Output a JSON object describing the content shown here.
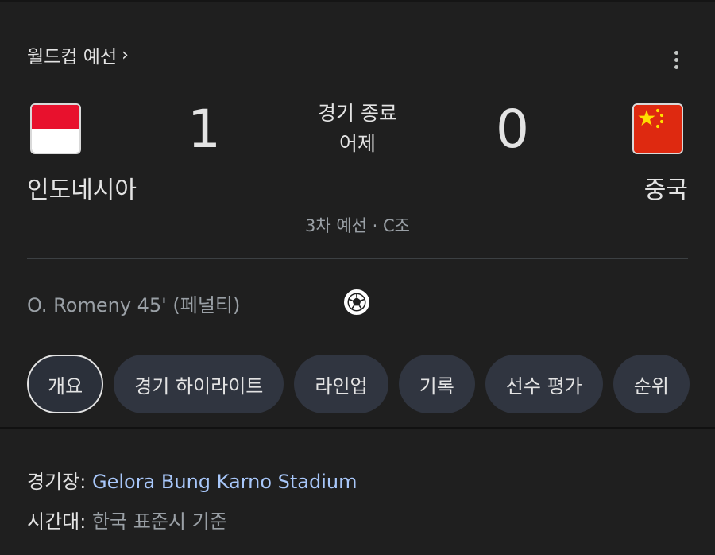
{
  "header": {
    "competition": "월드컵 예선",
    "chevron": "›"
  },
  "match": {
    "home": {
      "name": "인도네시아",
      "score": "1",
      "flag": "flag-indonesia-icon"
    },
    "away": {
      "name": "중국",
      "score": "0",
      "flag": "flag-china-icon"
    },
    "status": "경기 종료",
    "date": "어제",
    "round": "3차 예선 · C조"
  },
  "events": {
    "scorer": "O. Romeny 45' (페널티)",
    "icon": "soccer-ball-icon"
  },
  "tabs": [
    {
      "label": "개요",
      "active": true
    },
    {
      "label": "경기 하이라이트",
      "active": false
    },
    {
      "label": "라인업",
      "active": false
    },
    {
      "label": "기록",
      "active": false
    },
    {
      "label": "선수 평가",
      "active": false
    },
    {
      "label": "순위",
      "active": false
    }
  ],
  "info": {
    "venue_label": "경기장:",
    "venue_value": "Gelora Bung Karno Stadium",
    "tz_label": "시간대:",
    "tz_value": "한국 표준시 기준"
  },
  "colors": {
    "background": "#1f1f1f",
    "chip": "#303540",
    "link": "#a8c7fa",
    "muted": "#9aa0a6"
  }
}
